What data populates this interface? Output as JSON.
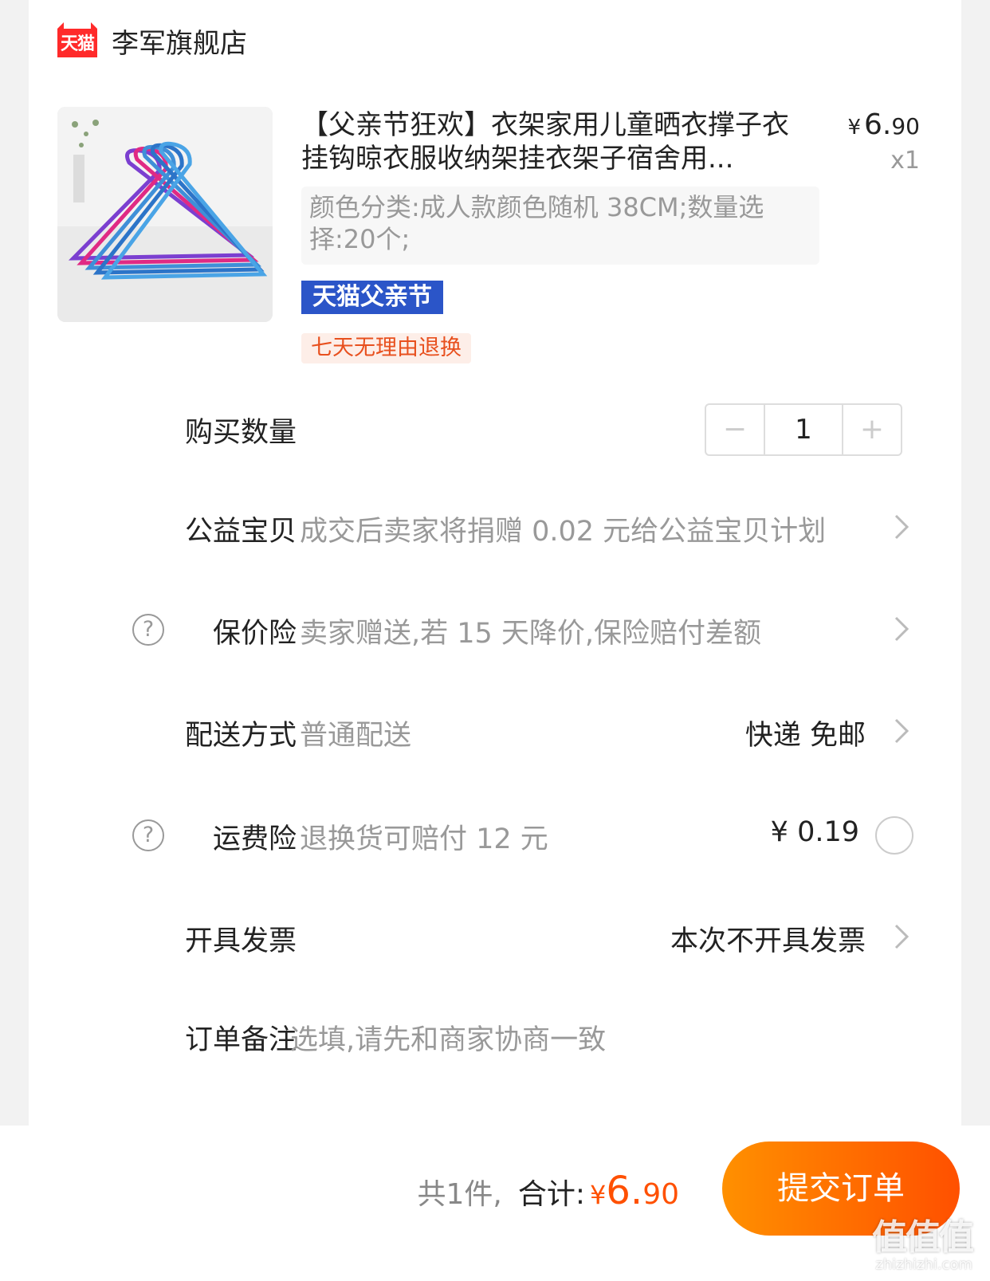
{
  "shop": {
    "badge_text": "天猫",
    "name": "李军旗舰店",
    "badge_color": "#ff2a2a"
  },
  "product": {
    "title": "【父亲节狂欢】衣架家用儿童晒衣撑子衣挂钩晾衣服收纳架挂衣架子宿舍用...",
    "price_symbol": "¥",
    "price_int": "6.",
    "price_dec": "90",
    "quantity_mark": "x1",
    "sku": "颜色分类:成人款颜色随机 38CM;数量选择:20个;",
    "promo_tag": "天猫父亲节",
    "return_tag": "七天无理由退换"
  },
  "rows": {
    "quantity": {
      "label": "购买数量",
      "minus": "−",
      "value": "1",
      "plus": "+"
    },
    "charity": {
      "label": "公益宝贝",
      "desc": "成交后卖家将捐赠 0.02 元给公益宝贝计划"
    },
    "price_protect": {
      "icon": "?",
      "label": "保价险",
      "desc": "卖家赠送,若 15 天降价,保险赔付差额"
    },
    "delivery": {
      "label": "配送方式",
      "desc": "普通配送",
      "value": "快递 免邮"
    },
    "shipping_insurance": {
      "icon": "?",
      "label": "运费险",
      "desc": "退换货可赔付 12 元",
      "value": "¥ 0.19"
    },
    "invoice": {
      "label": "开具发票",
      "value": "本次不开具发票"
    },
    "note": {
      "label": "订单备注",
      "placeholder": "选填,请先和商家协商一致"
    }
  },
  "footer": {
    "count": "共1件,",
    "total_label": "合计:",
    "yen": "¥",
    "amount_int": "6.",
    "amount_dec": "90",
    "submit": "提交订单"
  },
  "watermark": {
    "text": "值值值",
    "url": "zhizhizhi.com"
  },
  "colors": {
    "accent": "#ff5000",
    "promo_blue": "#2b55c8",
    "return_orange": "#e8501e"
  }
}
